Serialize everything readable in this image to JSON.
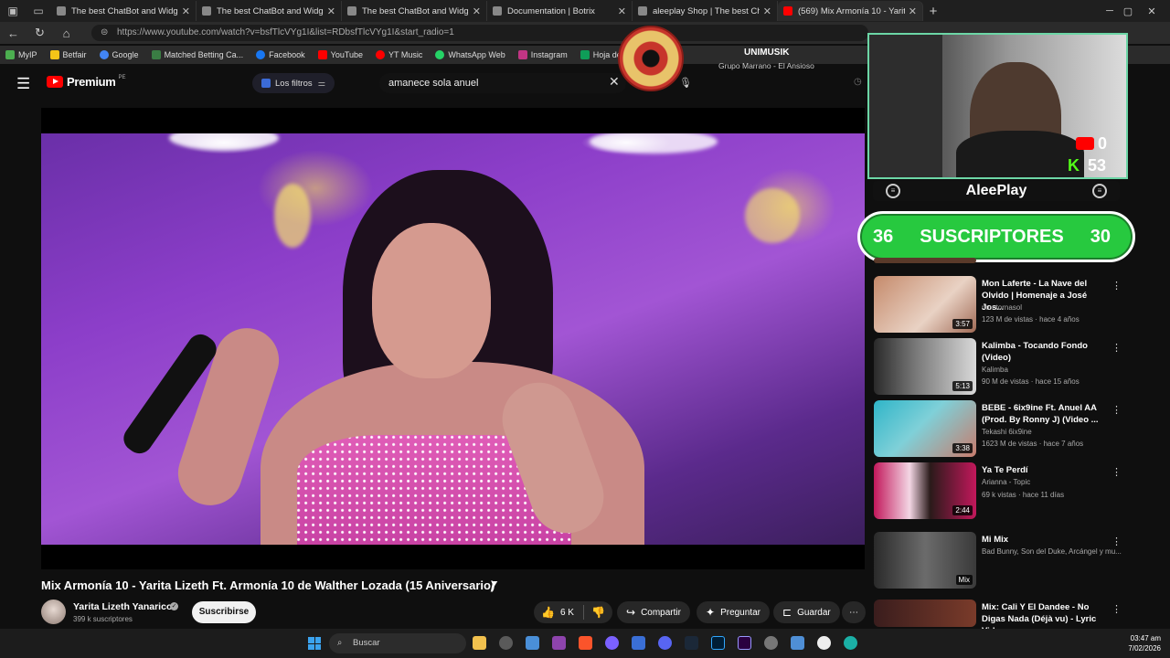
{
  "browser": {
    "tabs": [
      {
        "label": "The best ChatBot and Widgets fo",
        "active": false
      },
      {
        "label": "The best ChatBot and Widgets fo",
        "active": false
      },
      {
        "label": "The best ChatBot and Widgets fo",
        "active": false
      },
      {
        "label": "Documentation | Botrix",
        "active": false
      },
      {
        "label": "aleeplay Shop | The best ChatBot",
        "active": false
      },
      {
        "label": "(569) Mix Armonía 10 - Yarit",
        "active": true
      }
    ],
    "url": "https://www.youtube.com/watch?v=bsfTlcVYg1I&list=RDbsfTlcVYg1I&start_radio=1",
    "bookmarks": [
      {
        "label": "MyIP",
        "color": "#4caf50"
      },
      {
        "label": "Betfair",
        "color": "#f5c518"
      },
      {
        "label": "Google",
        "color": "#4285f4"
      },
      {
        "label": "Matched Betting Ca...",
        "color": "#3a7d44"
      },
      {
        "label": "Facebook",
        "color": "#1877f2"
      },
      {
        "label": "YouTube",
        "color": "#ff0000"
      },
      {
        "label": "YT Music",
        "color": "#ff0000"
      },
      {
        "label": "WhatsApp Web",
        "color": "#25d366"
      },
      {
        "label": "Instagram",
        "color": "#c13584"
      },
      {
        "label": "Hoja de Calculo",
        "color": "#0f9d58"
      }
    ]
  },
  "youtube": {
    "logo_text": "Premium",
    "region": "PE",
    "filters_label": "Los filtros",
    "search_value": "amanece sola anuel"
  },
  "video": {
    "title": "Mix Armonía 10 - Yarita Lizeth Ft. Armonía 10 de Walther Lozada (15 Aniversario)",
    "channel": "Yarita Lizeth Yanarico",
    "subscribers": "399 k suscriptores",
    "subscribe_label": "Suscribirse",
    "likes": "6 K",
    "share_label": "Compartir",
    "ask_label": "Preguntar",
    "save_label": "Guardar"
  },
  "now_playing": {
    "title": "UNIMUSIK",
    "artist": "Grupo Marrano - El Ansioso"
  },
  "stream_overlay": {
    "yt_count": "0",
    "kick_letter": "K",
    "kick_count": "53",
    "streamer": "AleePlay",
    "goal_current": "36",
    "goal_label": "SUSCRIPTORES",
    "goal_target": "30"
  },
  "recommendations": [
    {
      "title": "Mon Laferte - La Nave del Olvido | Homenaje a José Jos...",
      "channel": "montornasol",
      "stats": "123 M de vistas · hace 4 años",
      "duration": "3:57",
      "colors": [
        "#c58a6b",
        "#e9d2c4"
      ]
    },
    {
      "title": "Kalimba - Tocando Fondo (Video)",
      "channel": "Kalimba",
      "stats": "90 M de vistas · hace 15 años",
      "duration": "5:13",
      "colors": [
        "#d9d9d9",
        "#2a2a2a"
      ]
    },
    {
      "title": "BEBE - 6ix9ine Ft. Anuel AA (Prod. By Ronny J) (Video ...",
      "channel": "Tekashi 6ix9ine",
      "stats": "1623 M de vistas · hace 7 años",
      "duration": "3:38",
      "colors": [
        "#2fb5c8",
        "#c77b6c"
      ]
    },
    {
      "title": "Ya Te Perdí",
      "channel": "Arianna - Topic",
      "stats": "69 k vistas · hace 11 días",
      "duration": "2:44",
      "colors": [
        "#c2185b",
        "#f3d6e4"
      ]
    },
    {
      "title": "Mi Mix",
      "channel": "Bad Bunny, Son del Duke, Arcángel y mu...",
      "stats": "",
      "duration": "Mix",
      "colors": [
        "#6b6b6b",
        "#2a2a2a"
      ]
    },
    {
      "title": "Mix: Cali Y El Dandee - No Digas Nada (Déjà vu) - Lyric Video",
      "channel": "",
      "stats": "",
      "duration": "",
      "colors": [
        "#3a1d1d",
        "#7a3b2a"
      ]
    }
  ],
  "taskbar": {
    "search_placeholder": "Buscar",
    "time": "03:47 am",
    "date": "7/02/2026"
  }
}
